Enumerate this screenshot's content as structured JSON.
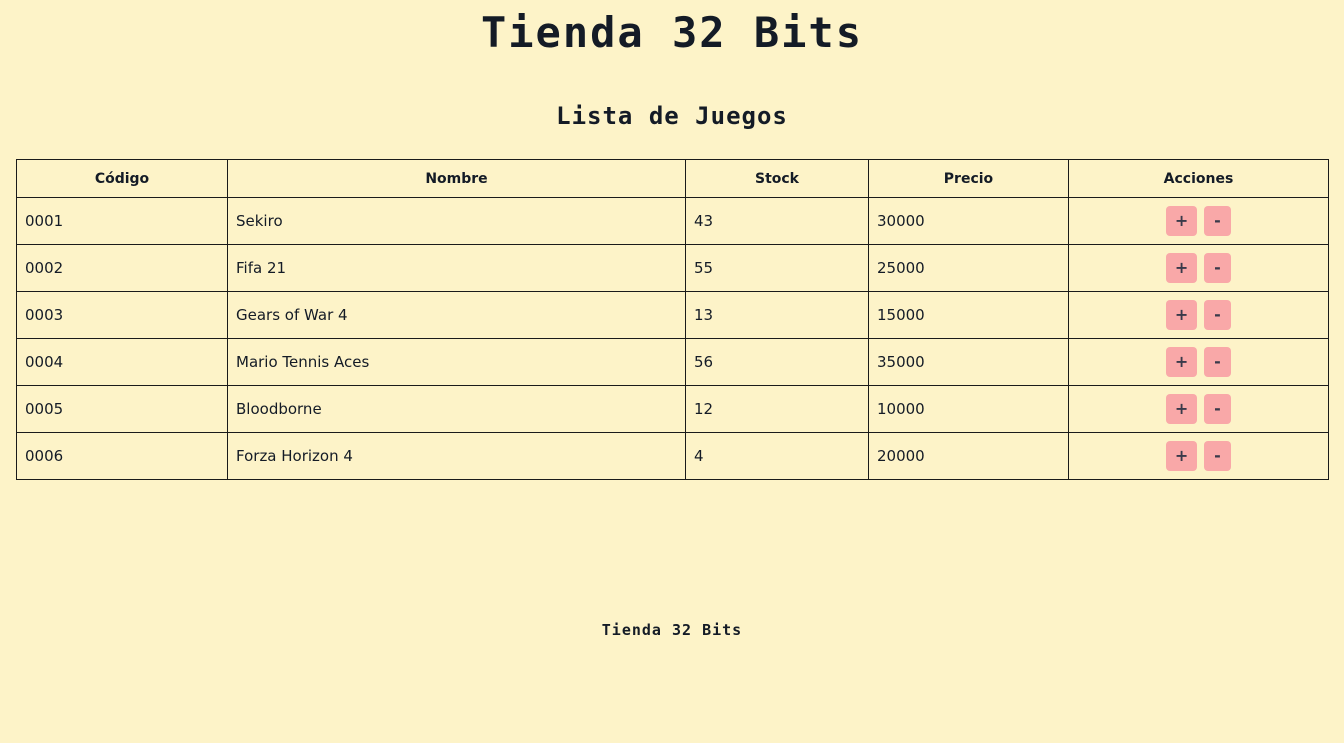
{
  "header": {
    "title": "Tienda 32 Bits"
  },
  "main": {
    "heading": "Lista de Juegos",
    "table": {
      "columns": [
        "Código",
        "Nombre",
        "Stock",
        "Precio",
        "Acciones"
      ],
      "rows": [
        {
          "codigo": "0001",
          "nombre": "Sekiro",
          "stock": "43",
          "precio": "30000"
        },
        {
          "codigo": "0002",
          "nombre": "Fifa 21",
          "stock": "55",
          "precio": "25000"
        },
        {
          "codigo": "0003",
          "nombre": "Gears of War 4",
          "stock": "13",
          "precio": "15000"
        },
        {
          "codigo": "0004",
          "nombre": "Mario Tennis Aces",
          "stock": "56",
          "precio": "35000"
        },
        {
          "codigo": "0005",
          "nombre": "Bloodborne",
          "stock": "12",
          "precio": "10000"
        },
        {
          "codigo": "0006",
          "nombre": "Forza Horizon 4",
          "stock": "4",
          "precio": "20000"
        }
      ],
      "actions": {
        "add_label": "+",
        "remove_label": "-"
      }
    }
  },
  "footer": {
    "text": "Tienda 32 Bits"
  },
  "colors": {
    "background": "#fdf3c8",
    "text": "#141b26",
    "button": "#f9a8a8"
  }
}
